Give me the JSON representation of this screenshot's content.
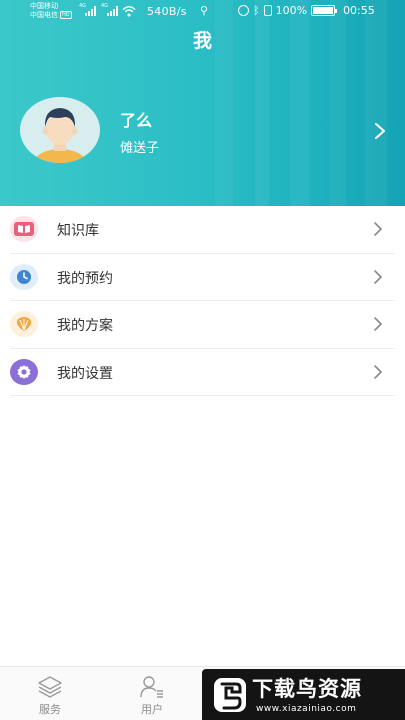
{
  "status_bar": {
    "carrier_1": "中国移动",
    "carrier_2": "中国电信",
    "hd_badge": "HD",
    "net_1": "4G",
    "net_2": "4G",
    "speed": "540B/s",
    "battery": "100%",
    "battery_level": 1.0,
    "time": "00:55",
    "icons": [
      "signal-icon",
      "wifi-icon",
      "usb-icon",
      "alarm-icon",
      "bluetooth-icon",
      "vibrate-icon",
      "battery-icon"
    ]
  },
  "header": {
    "title": "我",
    "colors": {
      "gradient_start": "#3cc8c9",
      "gradient_end": "#14a3b4"
    }
  },
  "profile": {
    "name": "了么",
    "subtitle": "傩送子",
    "avatar_icon": "user-avatar",
    "chevron_icon": "chevron-right-icon"
  },
  "menu": {
    "items": [
      {
        "label": "知识库",
        "icon": "book-icon",
        "color": "#e8607a",
        "bg": "#fbe3e8"
      },
      {
        "label": "我的预约",
        "icon": "clock-icon",
        "color": "#3d86d6",
        "bg": "#e1edf9"
      },
      {
        "label": "我的方案",
        "icon": "shell-icon",
        "color": "#f0a847",
        "bg": "#fdf0dc"
      },
      {
        "label": "我的设置",
        "icon": "gear-icon",
        "color": "#8a6fd6",
        "bg": "#8a6fd6"
      }
    ]
  },
  "tabbar": {
    "tabs": [
      {
        "label": "服务",
        "icon": "layers-icon"
      },
      {
        "label": "用户",
        "icon": "user-list-icon"
      }
    ]
  },
  "watermark": {
    "title": "下载鸟资源",
    "url": "www.xiazainiao.com"
  }
}
